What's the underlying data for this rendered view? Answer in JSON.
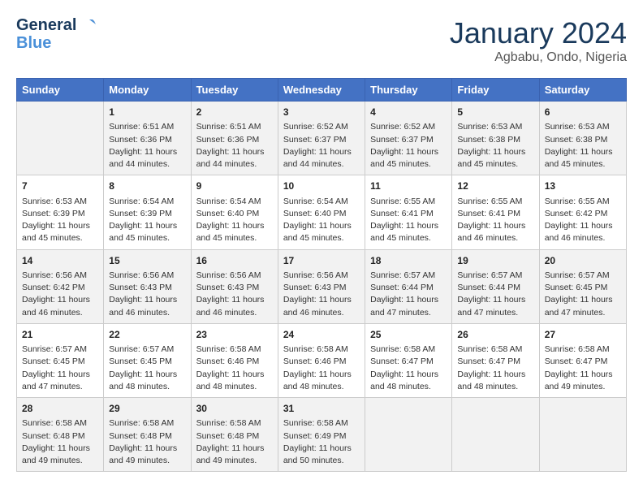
{
  "header": {
    "logo_line1": "General",
    "logo_line2": "Blue",
    "month": "January 2024",
    "location": "Agbabu, Ondo, Nigeria"
  },
  "days_of_week": [
    "Sunday",
    "Monday",
    "Tuesday",
    "Wednesday",
    "Thursday",
    "Friday",
    "Saturday"
  ],
  "weeks": [
    [
      {
        "day": "",
        "info": ""
      },
      {
        "day": "1",
        "info": "Sunrise: 6:51 AM\nSunset: 6:36 PM\nDaylight: 11 hours and 44 minutes."
      },
      {
        "day": "2",
        "info": "Sunrise: 6:51 AM\nSunset: 6:36 PM\nDaylight: 11 hours and 44 minutes."
      },
      {
        "day": "3",
        "info": "Sunrise: 6:52 AM\nSunset: 6:37 PM\nDaylight: 11 hours and 44 minutes."
      },
      {
        "day": "4",
        "info": "Sunrise: 6:52 AM\nSunset: 6:37 PM\nDaylight: 11 hours and 45 minutes."
      },
      {
        "day": "5",
        "info": "Sunrise: 6:53 AM\nSunset: 6:38 PM\nDaylight: 11 hours and 45 minutes."
      },
      {
        "day": "6",
        "info": "Sunrise: 6:53 AM\nSunset: 6:38 PM\nDaylight: 11 hours and 45 minutes."
      }
    ],
    [
      {
        "day": "7",
        "info": "Sunrise: 6:53 AM\nSunset: 6:39 PM\nDaylight: 11 hours and 45 minutes."
      },
      {
        "day": "8",
        "info": "Sunrise: 6:54 AM\nSunset: 6:39 PM\nDaylight: 11 hours and 45 minutes."
      },
      {
        "day": "9",
        "info": "Sunrise: 6:54 AM\nSunset: 6:40 PM\nDaylight: 11 hours and 45 minutes."
      },
      {
        "day": "10",
        "info": "Sunrise: 6:54 AM\nSunset: 6:40 PM\nDaylight: 11 hours and 45 minutes."
      },
      {
        "day": "11",
        "info": "Sunrise: 6:55 AM\nSunset: 6:41 PM\nDaylight: 11 hours and 45 minutes."
      },
      {
        "day": "12",
        "info": "Sunrise: 6:55 AM\nSunset: 6:41 PM\nDaylight: 11 hours and 46 minutes."
      },
      {
        "day": "13",
        "info": "Sunrise: 6:55 AM\nSunset: 6:42 PM\nDaylight: 11 hours and 46 minutes."
      }
    ],
    [
      {
        "day": "14",
        "info": "Sunrise: 6:56 AM\nSunset: 6:42 PM\nDaylight: 11 hours and 46 minutes."
      },
      {
        "day": "15",
        "info": "Sunrise: 6:56 AM\nSunset: 6:43 PM\nDaylight: 11 hours and 46 minutes."
      },
      {
        "day": "16",
        "info": "Sunrise: 6:56 AM\nSunset: 6:43 PM\nDaylight: 11 hours and 46 minutes."
      },
      {
        "day": "17",
        "info": "Sunrise: 6:56 AM\nSunset: 6:43 PM\nDaylight: 11 hours and 46 minutes."
      },
      {
        "day": "18",
        "info": "Sunrise: 6:57 AM\nSunset: 6:44 PM\nDaylight: 11 hours and 47 minutes."
      },
      {
        "day": "19",
        "info": "Sunrise: 6:57 AM\nSunset: 6:44 PM\nDaylight: 11 hours and 47 minutes."
      },
      {
        "day": "20",
        "info": "Sunrise: 6:57 AM\nSunset: 6:45 PM\nDaylight: 11 hours and 47 minutes."
      }
    ],
    [
      {
        "day": "21",
        "info": "Sunrise: 6:57 AM\nSunset: 6:45 PM\nDaylight: 11 hours and 47 minutes."
      },
      {
        "day": "22",
        "info": "Sunrise: 6:57 AM\nSunset: 6:45 PM\nDaylight: 11 hours and 48 minutes."
      },
      {
        "day": "23",
        "info": "Sunrise: 6:58 AM\nSunset: 6:46 PM\nDaylight: 11 hours and 48 minutes."
      },
      {
        "day": "24",
        "info": "Sunrise: 6:58 AM\nSunset: 6:46 PM\nDaylight: 11 hours and 48 minutes."
      },
      {
        "day": "25",
        "info": "Sunrise: 6:58 AM\nSunset: 6:47 PM\nDaylight: 11 hours and 48 minutes."
      },
      {
        "day": "26",
        "info": "Sunrise: 6:58 AM\nSunset: 6:47 PM\nDaylight: 11 hours and 48 minutes."
      },
      {
        "day": "27",
        "info": "Sunrise: 6:58 AM\nSunset: 6:47 PM\nDaylight: 11 hours and 49 minutes."
      }
    ],
    [
      {
        "day": "28",
        "info": "Sunrise: 6:58 AM\nSunset: 6:48 PM\nDaylight: 11 hours and 49 minutes."
      },
      {
        "day": "29",
        "info": "Sunrise: 6:58 AM\nSunset: 6:48 PM\nDaylight: 11 hours and 49 minutes."
      },
      {
        "day": "30",
        "info": "Sunrise: 6:58 AM\nSunset: 6:48 PM\nDaylight: 11 hours and 49 minutes."
      },
      {
        "day": "31",
        "info": "Sunrise: 6:58 AM\nSunset: 6:49 PM\nDaylight: 11 hours and 50 minutes."
      },
      {
        "day": "",
        "info": ""
      },
      {
        "day": "",
        "info": ""
      },
      {
        "day": "",
        "info": ""
      }
    ]
  ]
}
